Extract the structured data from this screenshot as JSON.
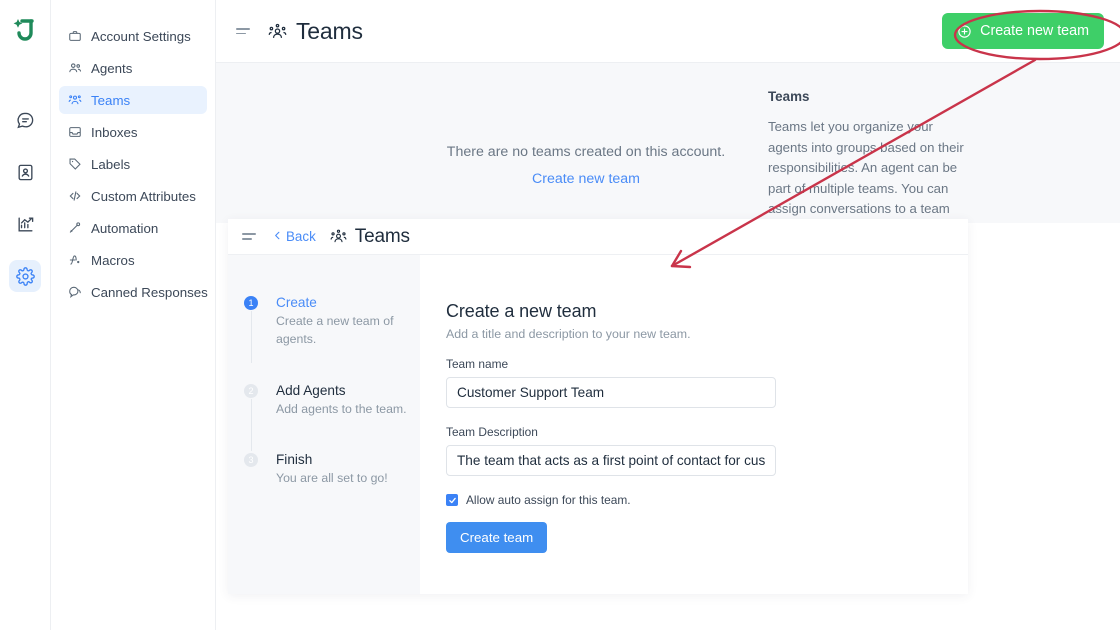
{
  "rail": {
    "logo": "chatwoot-logo-icon",
    "items": [
      {
        "name": "conversations-icon",
        "active": false
      },
      {
        "name": "contacts-icon",
        "active": false
      },
      {
        "name": "reports-icon",
        "active": false
      },
      {
        "name": "settings-icon",
        "active": true
      }
    ]
  },
  "sidebar": {
    "items": [
      {
        "label": "Account Settings",
        "icon": "briefcase-icon",
        "active": false
      },
      {
        "label": "Agents",
        "icon": "agents-icon",
        "active": false
      },
      {
        "label": "Teams",
        "icon": "teams-icon",
        "active": true
      },
      {
        "label": "Inboxes",
        "icon": "inbox-icon",
        "active": false
      },
      {
        "label": "Labels",
        "icon": "label-tag-icon",
        "active": false
      },
      {
        "label": "Custom Attributes",
        "icon": "code-icon",
        "active": false
      },
      {
        "label": "Automation",
        "icon": "automation-icon",
        "active": false
      },
      {
        "label": "Macros",
        "icon": "macros-icon",
        "active": false
      },
      {
        "label": "Canned Responses",
        "icon": "canned-response-icon",
        "active": false
      }
    ]
  },
  "header": {
    "menu_icon": "hamburger-icon",
    "title_icon": "teams-icon",
    "title": "Teams",
    "create_button": {
      "label": "Create new team",
      "icon": "plus-circle-icon",
      "color": "#3ecf68"
    }
  },
  "empty_state": {
    "message": "There are no teams created on this account.",
    "link": "Create new team"
  },
  "help": {
    "title": "Teams",
    "body": "Teams let you organize your agents into groups based on their responsibilities. An agent can be part of multiple teams. You can assign conversations to a team when you are working collaboratively."
  },
  "panel": {
    "menu_icon": "hamburger-icon",
    "back_label": "Back",
    "back_icon": "chevron-left-icon",
    "title_icon": "teams-icon",
    "title": "Teams",
    "steps": [
      {
        "number": "1",
        "title": "Create",
        "desc": "Create a new team of agents.",
        "active": true
      },
      {
        "number": "2",
        "title": "Add Agents",
        "desc": "Add agents to the team.",
        "active": false
      },
      {
        "number": "3",
        "title": "Finish",
        "desc": "You are all set to go!",
        "active": false
      }
    ],
    "form": {
      "title": "Create a new team",
      "subtitle": "Add a title and description to your new team.",
      "name_label": "Team name",
      "name_value": "Customer Support Team",
      "name_placeholder": "Team name",
      "description_label": "Team Description",
      "description_value": "The team that acts as a first point of contact for customers",
      "description_placeholder": "Team Description",
      "checkbox_label": "Allow auto assign for this team.",
      "checkbox_checked": true,
      "submit_label": "Create team",
      "submit_color": "#3f8ef0"
    }
  },
  "annotations": {
    "highlight_color": "#c9344a",
    "ellipse_target": "create-new-team-button",
    "arrow_points_to": "create-team-form"
  }
}
